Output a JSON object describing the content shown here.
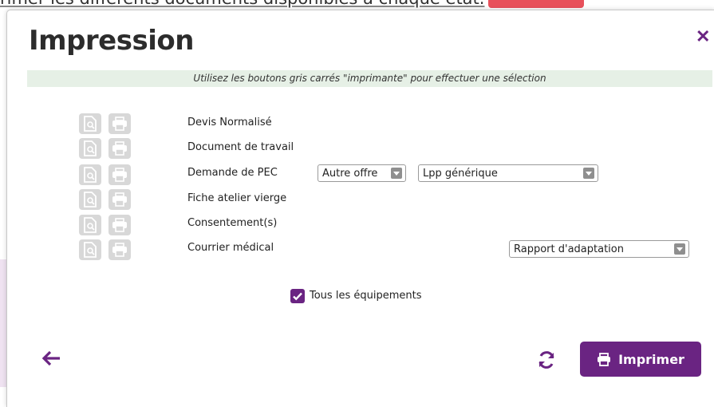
{
  "background": {
    "text": "rimer les différents documents disponibles à chaque état."
  },
  "modal": {
    "title": "Impression",
    "close_icon": "close-icon",
    "hint": "Utilisez les boutons gris carrés \"imprimante\" pour effectuer une sélection",
    "documents": [
      {
        "label": "Devis Normalisé"
      },
      {
        "label": "Document de travail"
      },
      {
        "label": "Demande de PEC"
      },
      {
        "label": "Fiche atelier vierge"
      },
      {
        "label": "Consentement(s)"
      },
      {
        "label": "Courrier médical"
      }
    ],
    "selects": {
      "pec_offer": "Autre offre",
      "pec_lpp": "Lpp générique",
      "courrier_type": "Rapport d'adaptation"
    },
    "checkbox": {
      "label": "Tous les équipements",
      "checked": true
    },
    "footer": {
      "print_label": "Imprimer"
    }
  },
  "colors": {
    "accent": "#6a2482",
    "hint_bg": "#e6f0e6",
    "icon_bg": "#d8d8d8"
  }
}
